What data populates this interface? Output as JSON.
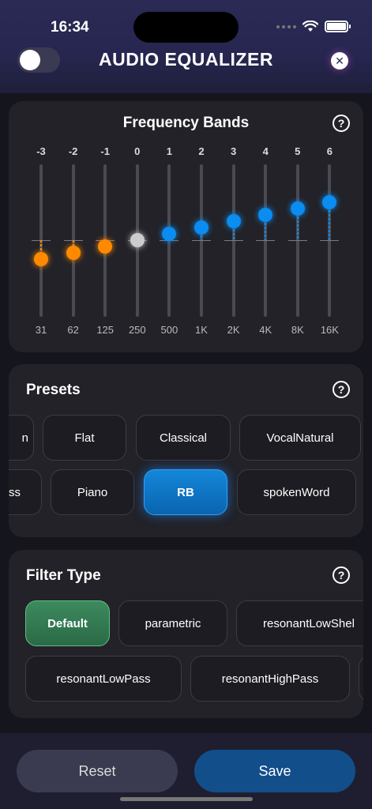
{
  "status": {
    "time": "16:34"
  },
  "header": {
    "title": "AUDIO EQUALIZER",
    "close_glyph": "✕",
    "toggle_on": false
  },
  "bands_card": {
    "title": "Frequency Bands",
    "help": "?",
    "bands": [
      {
        "value": "-3",
        "freq": "31",
        "gain": -3,
        "color": "#ff8a00"
      },
      {
        "value": "-2",
        "freq": "62",
        "gain": -2,
        "color": "#ff8a00"
      },
      {
        "value": "-1",
        "freq": "125",
        "gain": -1,
        "color": "#ff8a00"
      },
      {
        "value": "0",
        "freq": "250",
        "gain": 0,
        "color": "#cccccc"
      },
      {
        "value": "1",
        "freq": "500",
        "gain": 1,
        "color": "#0a8cf0"
      },
      {
        "value": "2",
        "freq": "1K",
        "gain": 2,
        "color": "#0a8cf0"
      },
      {
        "value": "3",
        "freq": "2K",
        "gain": 3,
        "color": "#0a8cf0"
      },
      {
        "value": "4",
        "freq": "4K",
        "gain": 4,
        "color": "#0a8cf0"
      },
      {
        "value": "5",
        "freq": "8K",
        "gain": 5,
        "color": "#0a8cf0"
      },
      {
        "value": "6",
        "freq": "16K",
        "gain": 6,
        "color": "#0a8cf0"
      }
    ]
  },
  "presets_card": {
    "title": "Presets",
    "help": "?",
    "row1": [
      "n",
      "Flat",
      "Classical",
      "VocalNatural"
    ],
    "row2": [
      "ss",
      "Piano",
      "RB",
      "spokenWord"
    ],
    "selected": "RB"
  },
  "filter_card": {
    "title": "Filter Type",
    "help": "?",
    "row1": [
      "Default",
      "parametric",
      "resonantLowShel"
    ],
    "row2": [
      "resonantLowPass",
      "resonantHighPass",
      ""
    ],
    "selected": "Default"
  },
  "footer": {
    "reset_label": "Reset",
    "save_label": "Save"
  },
  "colors": {
    "accent_blue": "#0a8cf0",
    "accent_orange": "#ff8a00",
    "accent_green": "#3d8a5e"
  }
}
